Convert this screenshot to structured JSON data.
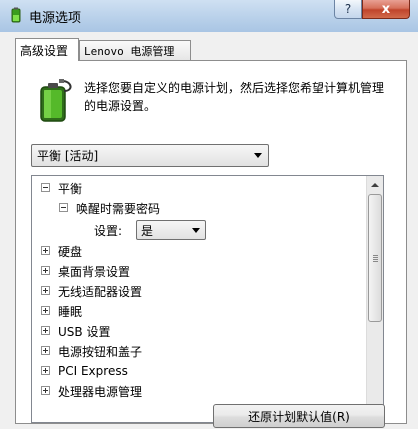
{
  "window": {
    "title": "电源选项",
    "help_label": "?",
    "close_label": "x"
  },
  "tabs": [
    {
      "label": "高级设置",
      "active": true
    },
    {
      "label": "Lenovo 电源管理",
      "active": false
    }
  ],
  "description": "选择您要自定义的电源计划，然后选择您希望计算机管理的电源设置。",
  "plan_select": {
    "value": "平衡 [活动]"
  },
  "tree": {
    "root": "平衡",
    "wake_password": "唤醒时需要密码",
    "setting_label": "设置:",
    "setting_value": "是",
    "items": [
      "硬盘",
      "桌面背景设置",
      "无线适配器设置",
      "睡眠",
      "USB 设置",
      "电源按钮和盖子",
      "PCI Express",
      "处理器电源管理"
    ]
  },
  "restore_button": "还原计划默认值(R)",
  "colors": {
    "titlebar": "#b9d1ea",
    "close": "#c0442c",
    "battery": "#5bbf2a"
  },
  "icons": {
    "app": "battery-plug-icon",
    "plan": "battery-plug-icon"
  }
}
